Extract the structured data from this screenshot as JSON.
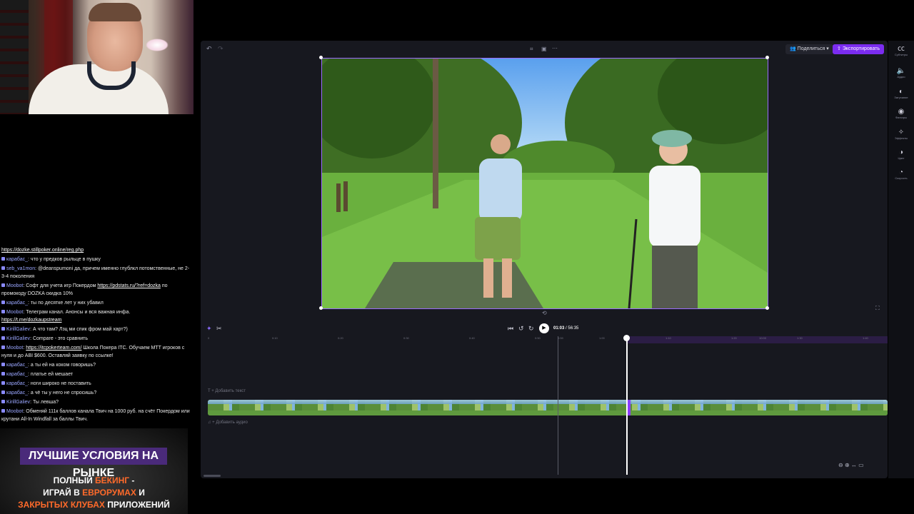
{
  "chat": {
    "lines": [
      {
        "user": "",
        "text": "",
        "link": "https://dozke.stillpoker.online/reg.php"
      },
      {
        "user": "карабас_",
        "text": "что у предков рыльце в пушку"
      },
      {
        "user": "seb_va1mon",
        "text": "@deanspumoni да, причем именно глублкл потомственные, не 2-3-4 поколения"
      },
      {
        "user": "Moobot",
        "text": "Софт для учета игр Покердом",
        "link": "https://pdstats.ru/?ref=dozka",
        "text2": "по промокоду DOZKA скидка 10%"
      },
      {
        "user": "карабас_",
        "text": "ты по десятке лет у них убавил"
      },
      {
        "user": "Moobot",
        "text": "Телеграм канал. Анонсы и вся важная инфа.",
        "link": "https://t.me/dozkaupstream"
      },
      {
        "user": "KirillGaliev",
        "text": "А что там? Лзц ми спик фром май харт?)"
      },
      {
        "user": "KirillGaliev",
        "text": "Compare - это сравнить"
      },
      {
        "user": "Moobot",
        "link": "https://itcpokerteam.com/",
        "text": "Школа Покера ITC. Обучаем МТТ игроков с нуля и до ABI $600. Оставляй заявку по ссылке!"
      },
      {
        "user": "карабас_",
        "text": "а ты ей на коком говоришь?"
      },
      {
        "user": "карабас_",
        "text": "платье ей мешает"
      },
      {
        "user": "карабас_",
        "text": "ноги широко не поставить"
      },
      {
        "user": "карабас_",
        "text": "а чё ты у него не спросишь?"
      },
      {
        "user": "KirillGaliev",
        "text": "Ты левша?"
      },
      {
        "user": "Moobot",
        "text": "Обменяй 111к баллов канала Твич на 1000 руб. на счёт Покердом или крутани All-In Windfall за баллы Твич."
      }
    ]
  },
  "ad": {
    "title": "ЛУЧШИЕ УСЛОВИЯ НА РЫНКЕ",
    "line1_a": "ПОЛНЫЙ ",
    "line1_b": "БЕКИНГ",
    "line1_c": " -",
    "line2_a": "ИГРАЙ В ",
    "line2_b": "ЕВРОРУМАХ",
    "line2_c": " И",
    "line3_a": "ЗАКРЫТЫХ КЛУБАХ",
    "line3_b": " ПРИЛОЖЕНИЙ"
  },
  "editor": {
    "share_label": "Поделиться",
    "export_label": "Экспортировать",
    "timecode_current": "01:03",
    "timecode_total": "/ 56:35",
    "add_text_label": "+ Добавить текст",
    "add_audio_label": "+ Добавить аудио",
    "ruler_ticks": [
      "0",
      "0:10",
      "0:20",
      "0:30",
      "0:40",
      "0:50",
      "0:59",
      "1:00",
      "1:10",
      "1:20",
      "10:00",
      "1:30",
      "1:40"
    ]
  },
  "rail": {
    "items": [
      {
        "icon": "subtitles-icon",
        "label": "Субтитры"
      },
      {
        "icon": "audio-icon",
        "label": "Аудио"
      },
      {
        "icon": "fade-icon",
        "label": "Затухание"
      },
      {
        "icon": "filters-icon",
        "label": "Фильтры"
      },
      {
        "icon": "effects-icon",
        "label": "Эффекты"
      },
      {
        "icon": "color-icon",
        "label": "Цвет"
      },
      {
        "icon": "speed-icon",
        "label": "Скорость"
      }
    ]
  },
  "colors": {
    "accent": "#7b2cf0",
    "editor_bg": "#17181f",
    "chat_user": "#9aa6ff"
  }
}
